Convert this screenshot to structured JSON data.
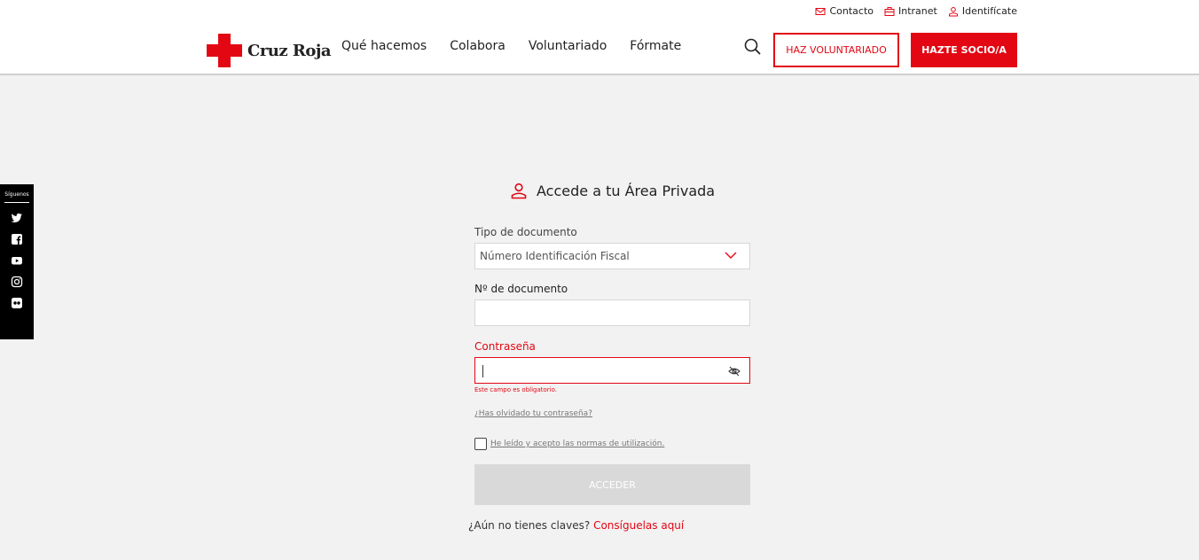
{
  "util_bar": {
    "contact": "Contacto",
    "intranet": "Intranet",
    "identify": "Identifícate"
  },
  "brand": {
    "name": "Cruz Roja",
    "color": "#e30613"
  },
  "nav": {
    "items": [
      "Qué hacemos",
      "Colabora",
      "Voluntariado",
      "Fórmate"
    ],
    "volunteer_button": "HAZ VOLUNTARIADO",
    "member_button": "HAZTE SOCIO/A"
  },
  "social": {
    "title": "Síguenos",
    "icons": [
      "twitter-icon",
      "facebook-icon",
      "youtube-icon",
      "instagram-icon",
      "flickr-icon"
    ]
  },
  "login": {
    "title": "Accede a tu Área Privada",
    "doc_type_label": "Tipo de documento",
    "doc_type_value": "Número Identificación Fiscal",
    "doc_number_label": "Nº de documento",
    "doc_number_value": "",
    "password_label": "Contraseña",
    "password_value": "",
    "password_error": "Este campo es obligatorio.",
    "forgot_link": "¿Has olvidado tu contraseña?",
    "terms_label": "He leído y acepto las normas de utilización.",
    "terms_checked": false,
    "submit_label": "ACCEDER",
    "register_text": "¿Aún no tienes claves?",
    "register_link": "Consíguelas aquí"
  }
}
